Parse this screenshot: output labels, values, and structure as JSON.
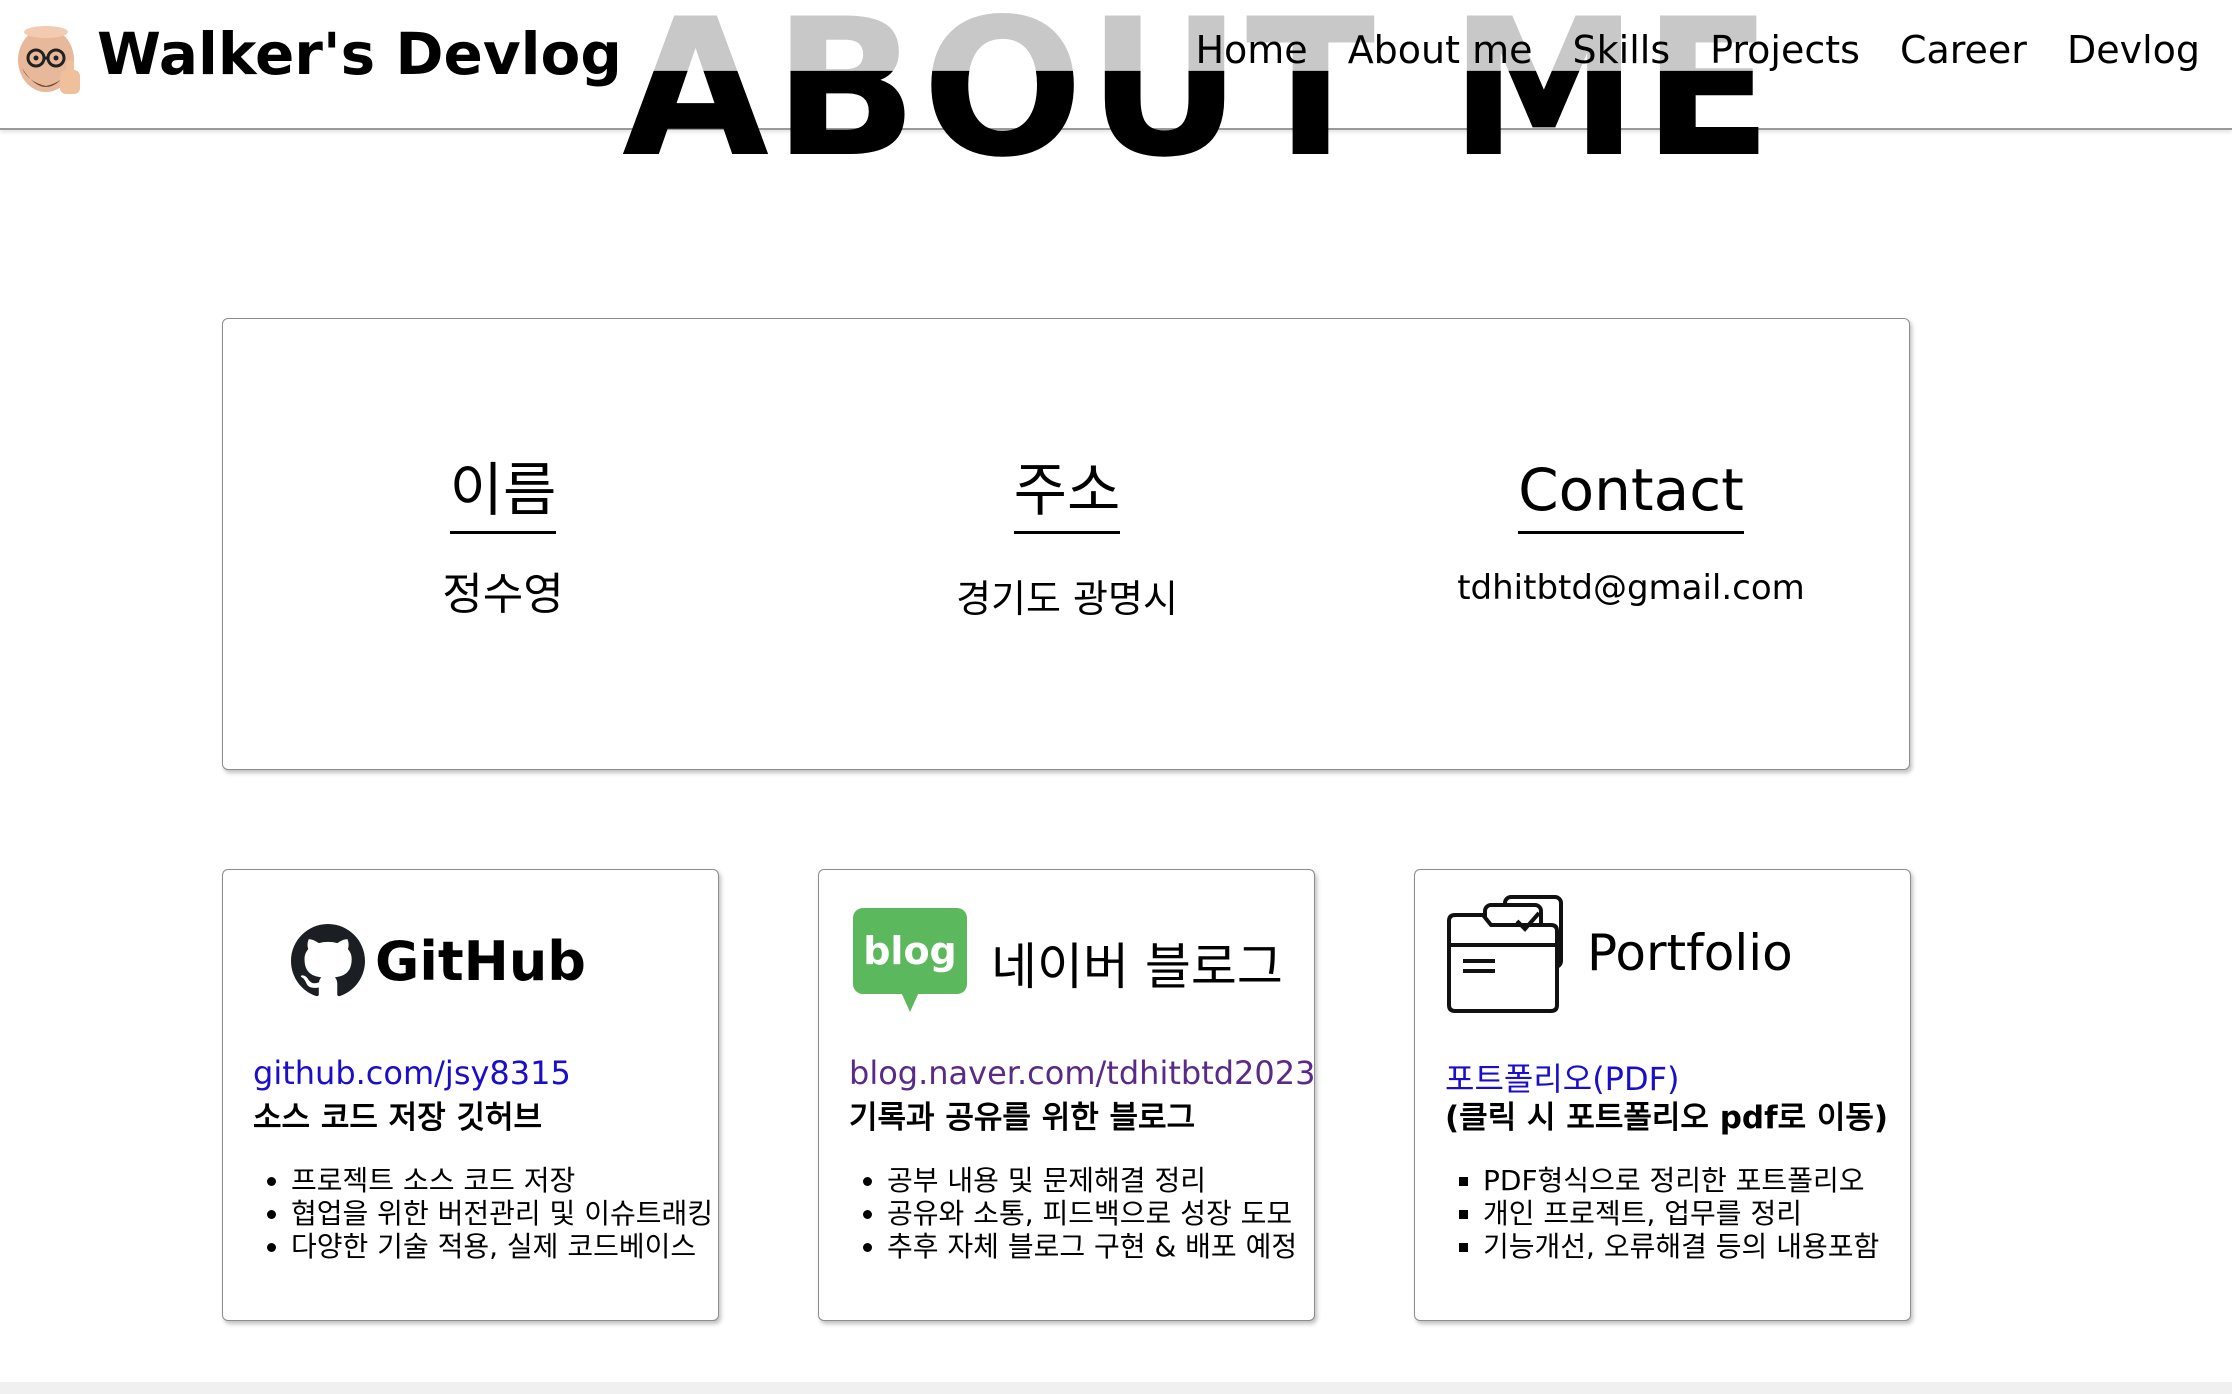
{
  "header": {
    "site_title": "Walker's Devlog",
    "nav": [
      "Home",
      "About me",
      "Skills",
      "Projects",
      "Career",
      "Devlog"
    ]
  },
  "hero": {
    "title": "ABOUT ME"
  },
  "info": {
    "name": {
      "heading": "이름",
      "value": "정수영"
    },
    "address": {
      "heading": "주소",
      "value": "경기도 광명시"
    },
    "contact": {
      "heading": "Contact",
      "value": "tdhitbtd@gmail.com"
    }
  },
  "cards": {
    "github": {
      "brand": "GitHub",
      "link": "github.com/jsy8315",
      "description": "소스 코드 저장 깃허브",
      "items": [
        "프로젝트 소스 코드 저장",
        "협업을 위한 버전관리 및 이슈트래킹",
        "다양한 기술 적용, 실제 코드베이스"
      ]
    },
    "blog": {
      "badge": "blog",
      "brand": "네이버 블로그",
      "link": "blog.naver.com/tdhitbtd2023",
      "description": "기록과 공유를 위한 블로그",
      "items": [
        "공부 내용 및 문제해결 정리",
        "공유와 소통, 피드백으로 성장 도모",
        "추후 자체 블로그 구현 & 배포 예정"
      ]
    },
    "portfolio": {
      "brand": "Portfolio",
      "link": "포트폴리오(PDF)",
      "description": "(클릭 시 포트폴리오 pdf로 이동)",
      "items": [
        "PDF형식으로 정리한 포트폴리오",
        "개인 프로젝트, 업무를 정리",
        "기능개선, 오류해결 등의 내용포함"
      ]
    }
  },
  "colors": {
    "link": "#1a0dcc",
    "visited_link": "#5a2a88",
    "naver_green": "#5cb85c",
    "hero_grey": "#c8c8c8"
  }
}
